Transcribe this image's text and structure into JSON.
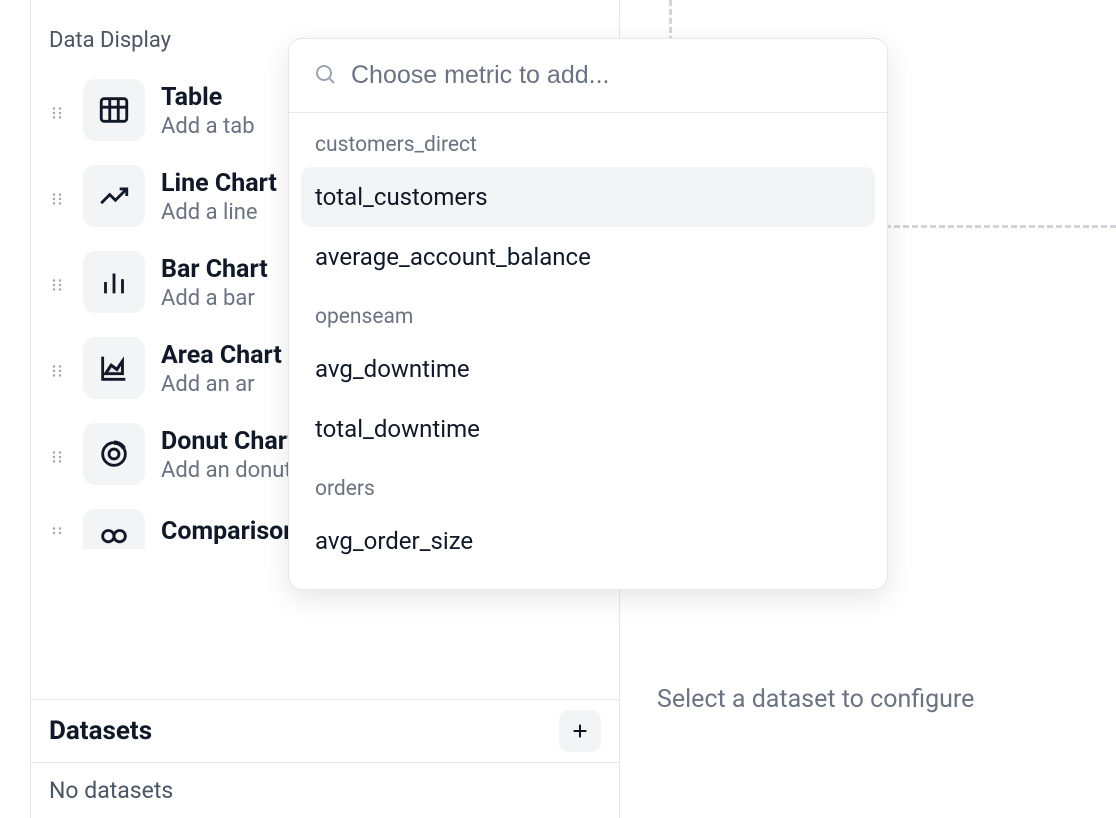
{
  "sidebar": {
    "section_label": "Data Display",
    "components": [
      {
        "title": "Table",
        "desc": "Add a tab",
        "icon": "table"
      },
      {
        "title": "Line Chart",
        "desc": "Add a line",
        "icon": "line-chart"
      },
      {
        "title": "Bar Chart",
        "desc": "Add a bar",
        "icon": "bar-chart"
      },
      {
        "title": "Area Chart",
        "desc": "Add an ar",
        "icon": "area-chart"
      },
      {
        "title": "Donut Chart",
        "desc": "Add an donut chart to the dashboard",
        "icon": "donut-chart"
      },
      {
        "title": "Comparison",
        "desc": "",
        "icon": "comparison"
      }
    ]
  },
  "datasets": {
    "title": "Datasets",
    "empty_text": "No datasets"
  },
  "canvas": {
    "config_prompt": "Select a dataset to configure"
  },
  "metric_popover": {
    "search_placeholder": "Choose metric to add...",
    "groups": [
      {
        "name": "customers_direct",
        "metrics": [
          "total_customers",
          "average_account_balance"
        ]
      },
      {
        "name": "openseam",
        "metrics": [
          "avg_downtime",
          "total_downtime"
        ]
      },
      {
        "name": "orders",
        "metrics": [
          "avg_order_size"
        ]
      }
    ],
    "highlighted": "total_customers"
  }
}
